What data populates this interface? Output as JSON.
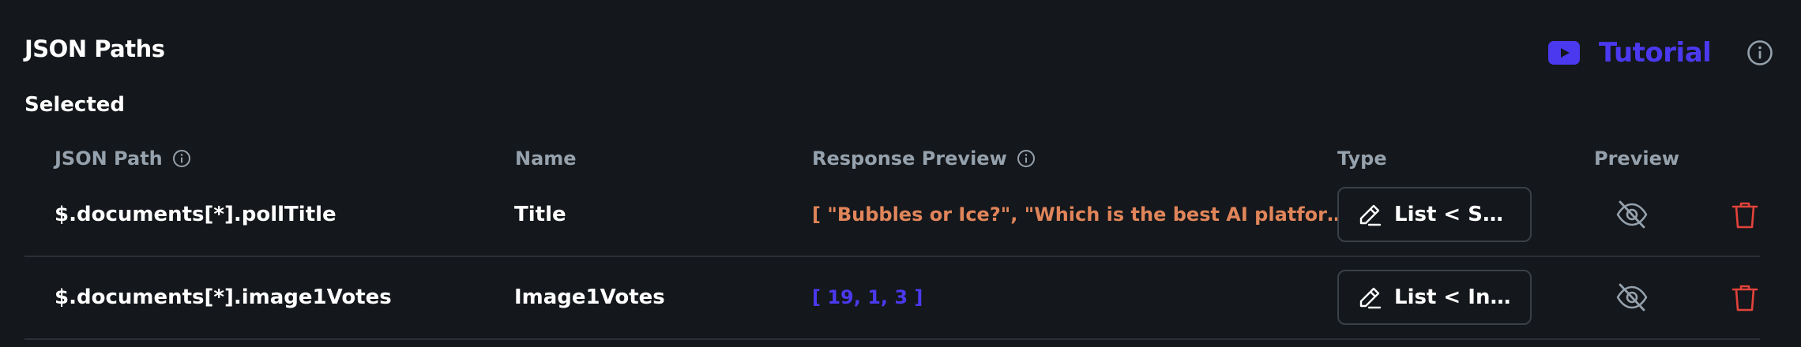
{
  "section": {
    "title": "JSON Paths",
    "tutorial_label": "Tutorial",
    "selected_label": "Selected"
  },
  "columns": {
    "json_path": "JSON Path",
    "name": "Name",
    "response_preview": "Response Preview",
    "type": "Type",
    "preview": "Preview"
  },
  "rows": [
    {
      "json_path": "$.documents[*].pollTitle",
      "name": "Title",
      "response_preview": "[  \"Bubbles or Ice?\",  \"Which is the best AI platform?\",  \"Cats vs Dogs?\" ]",
      "type": "List < String >"
    },
    {
      "json_path": "$.documents[*].image1Votes",
      "name": "Image1Votes",
      "response_preview": "[  19,  1,  3 ]",
      "type": "List < Integer >"
    }
  ],
  "icons": {
    "tutorial": "youtube-play-icon",
    "info": "info-icon",
    "edit": "pencil-icon",
    "preview": "eye-off-icon",
    "delete": "trash-icon"
  },
  "colors": {
    "background": "#14171b",
    "accent": "#4b39ef",
    "string_preview": "#e0855a",
    "delete": "#e2433b",
    "muted": "#95a1ac"
  }
}
